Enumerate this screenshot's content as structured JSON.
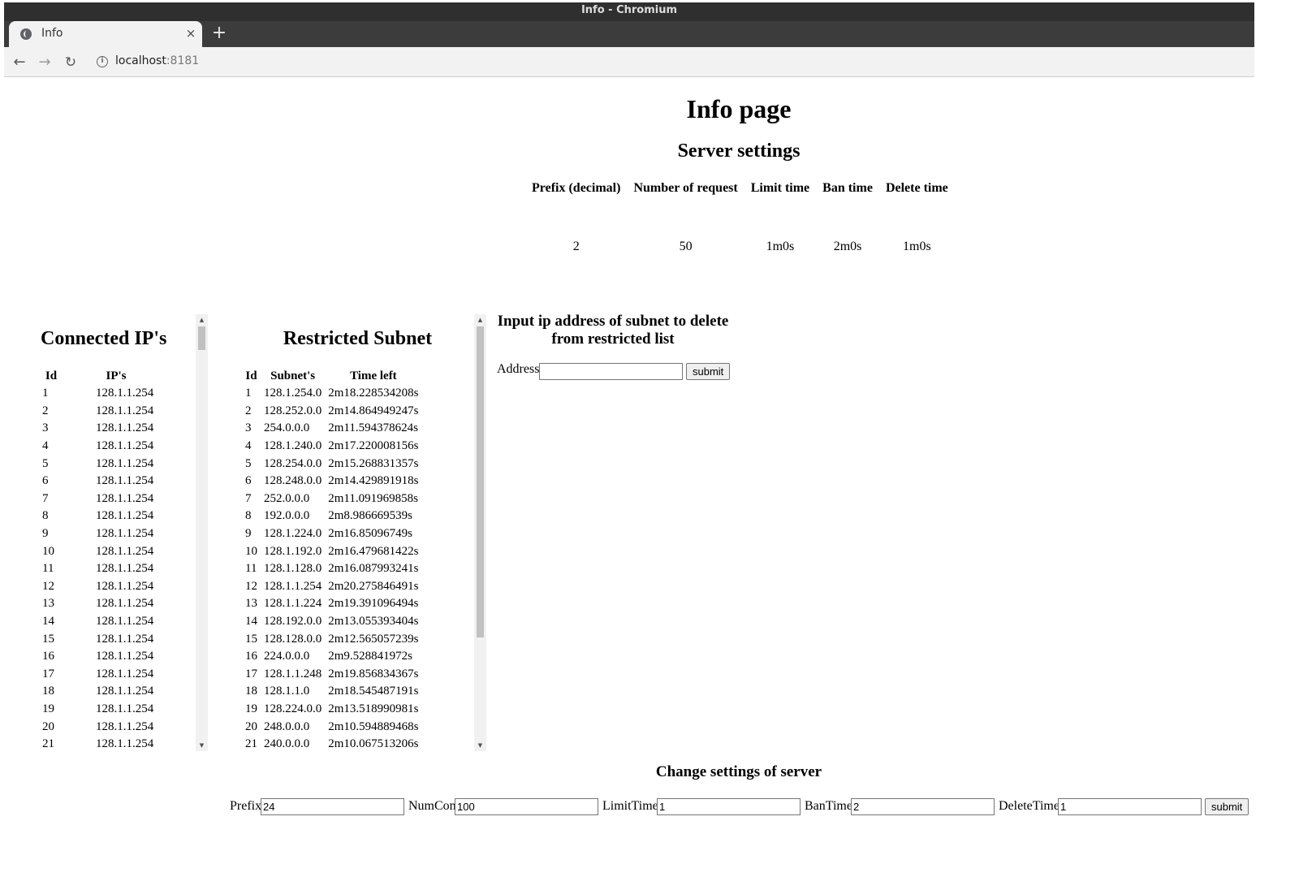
{
  "window": {
    "title": "Info - Chromium"
  },
  "tab": {
    "title": "Info",
    "close": "×",
    "new_tab": "+"
  },
  "toolbar": {
    "back": "←",
    "forward": "→",
    "reload": "↻",
    "info": "i",
    "url_host": "localhost",
    "url_port": ":8181"
  },
  "page": {
    "title": "Info page"
  },
  "server_settings": {
    "title": "Server settings",
    "headers": [
      "Prefix (decimal)",
      "Number of request",
      "Limit time",
      "Ban time",
      "Delete time"
    ],
    "values": [
      "2",
      "50",
      "1m0s",
      "2m0s",
      "1m0s"
    ]
  },
  "connected": {
    "title": "Connected IP's",
    "headers": [
      "Id",
      "IP's"
    ],
    "rows": [
      [
        "1",
        "128.1.1.254"
      ],
      [
        "2",
        "128.1.1.254"
      ],
      [
        "3",
        "128.1.1.254"
      ],
      [
        "4",
        "128.1.1.254"
      ],
      [
        "5",
        "128.1.1.254"
      ],
      [
        "6",
        "128.1.1.254"
      ],
      [
        "7",
        "128.1.1.254"
      ],
      [
        "8",
        "128.1.1.254"
      ],
      [
        "9",
        "128.1.1.254"
      ],
      [
        "10",
        "128.1.1.254"
      ],
      [
        "11",
        "128.1.1.254"
      ],
      [
        "12",
        "128.1.1.254"
      ],
      [
        "13",
        "128.1.1.254"
      ],
      [
        "14",
        "128.1.1.254"
      ],
      [
        "15",
        "128.1.1.254"
      ],
      [
        "16",
        "128.1.1.254"
      ],
      [
        "17",
        "128.1.1.254"
      ],
      [
        "18",
        "128.1.1.254"
      ],
      [
        "19",
        "128.1.1.254"
      ],
      [
        "20",
        "128.1.1.254"
      ],
      [
        "21",
        "128.1.1.254"
      ]
    ]
  },
  "restricted": {
    "title": "Restricted Subnet",
    "headers": [
      "Id",
      "Subnet's",
      "Time left"
    ],
    "rows": [
      [
        "1",
        "128.1.254.0",
        "2m18.228534208s"
      ],
      [
        "2",
        "128.252.0.0",
        "2m14.864949247s"
      ],
      [
        "3",
        "254.0.0.0",
        "2m11.594378624s"
      ],
      [
        "4",
        "128.1.240.0",
        "2m17.220008156s"
      ],
      [
        "5",
        "128.254.0.0",
        "2m15.268831357s"
      ],
      [
        "6",
        "128.248.0.0",
        "2m14.429891918s"
      ],
      [
        "7",
        "252.0.0.0",
        "2m11.091969858s"
      ],
      [
        "8",
        "192.0.0.0",
        "2m8.986669539s"
      ],
      [
        "9",
        "128.1.224.0",
        "2m16.85096749s"
      ],
      [
        "10",
        "128.1.192.0",
        "2m16.479681422s"
      ],
      [
        "11",
        "128.1.128.0",
        "2m16.087993241s"
      ],
      [
        "12",
        "128.1.1.254",
        "2m20.275846491s"
      ],
      [
        "13",
        "128.1.1.224",
        "2m19.391096494s"
      ],
      [
        "14",
        "128.192.0.0",
        "2m13.055393404s"
      ],
      [
        "15",
        "128.128.0.0",
        "2m12.565057239s"
      ],
      [
        "16",
        "224.0.0.0",
        "2m9.528841972s"
      ],
      [
        "17",
        "128.1.1.248",
        "2m19.856834367s"
      ],
      [
        "18",
        "128.1.1.0",
        "2m18.545487191s"
      ],
      [
        "19",
        "128.224.0.0",
        "2m13.518990981s"
      ],
      [
        "20",
        "248.0.0.0",
        "2m10.594889468s"
      ],
      [
        "21",
        "240.0.0.0",
        "2m10.067513206s"
      ]
    ]
  },
  "delete_form": {
    "heading": "Input ip address of subnet to delete from restricted list",
    "label": "Address",
    "value": "",
    "submit": "submit"
  },
  "change_form": {
    "title": "Change settings of server",
    "fields": [
      {
        "label": "Prefix",
        "value": "24"
      },
      {
        "label": "NumCon",
        "value": "100"
      },
      {
        "label": "LimitTime",
        "value": "1"
      },
      {
        "label": "BanTime",
        "value": "2"
      },
      {
        "label": "DeleteTime",
        "value": "1"
      }
    ],
    "submit": "submit"
  }
}
